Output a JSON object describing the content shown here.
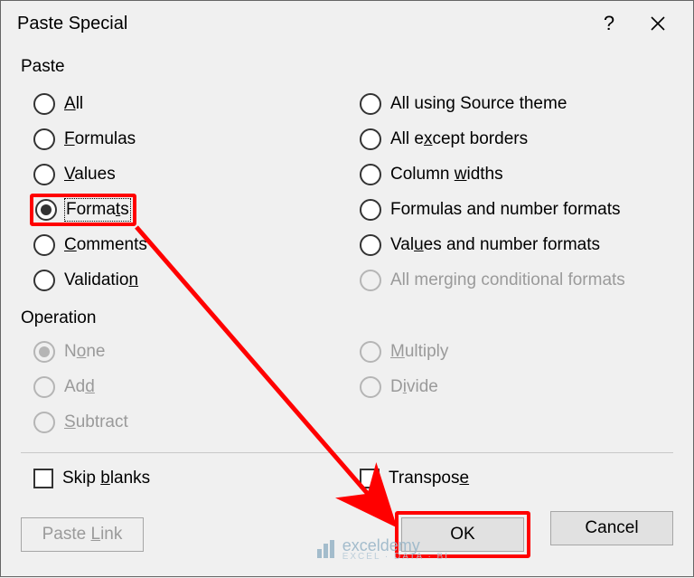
{
  "title": "Paste Special",
  "groups": {
    "paste": "Paste",
    "operation": "Operation"
  },
  "paste_left": {
    "all": "All",
    "formulas": "Formulas",
    "values": "Values",
    "formats": "Formats",
    "comments": "Comments",
    "validation": "Validation"
  },
  "paste_right": {
    "all_theme": "All using Source theme",
    "all_except_borders": "All except borders",
    "column_widths": "Column widths",
    "formulas_num": "Formulas and number formats",
    "values_num": "Values and number formats",
    "all_merging": "All merging conditional formats"
  },
  "operation_left": {
    "none": "None",
    "add": "Add",
    "subtract": "Subtract"
  },
  "operation_right": {
    "multiply": "Multiply",
    "divide": "Divide"
  },
  "checks": {
    "skip_blanks": "Skip blanks",
    "transpose": "Transpose"
  },
  "buttons": {
    "paste_link": "Paste Link",
    "ok": "OK",
    "cancel": "Cancel"
  },
  "watermark": {
    "text": "exceldemy",
    "sub": "EXCEL · DATA · BI"
  },
  "underline": {
    "all": "A",
    "formulas": "F",
    "values": "V",
    "formats": "t",
    "comments": "C",
    "validation": "n",
    "all_theme": "H",
    "all_except_borders": "x",
    "column_widths": "w",
    "formulas_num": "R",
    "values_num": "u",
    "none": "o",
    "add": "d",
    "subtract": "S",
    "multiply": "M",
    "divide": "i",
    "skip_blanks": "b",
    "transpose": "e",
    "paste_link": "L"
  }
}
